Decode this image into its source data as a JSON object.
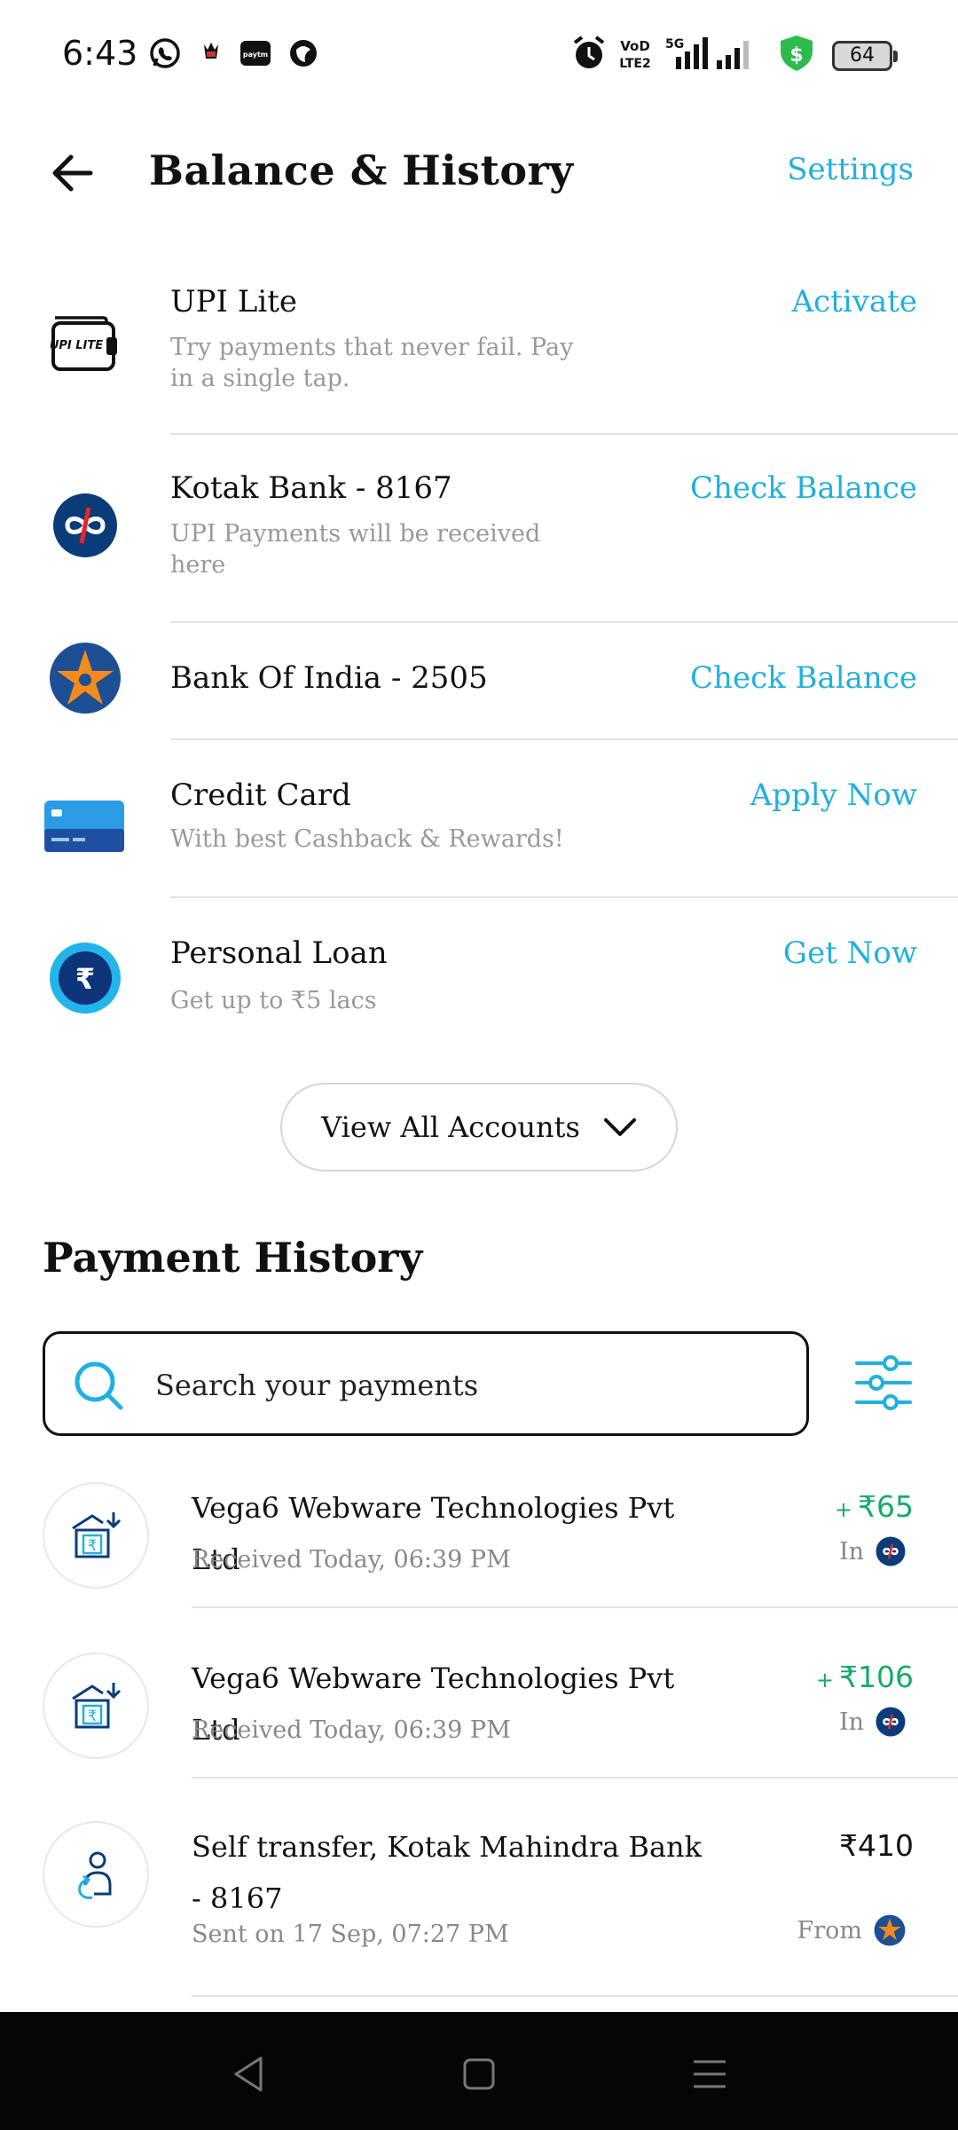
{
  "status_bar": {
    "time": "6:43",
    "battery": "64",
    "network": "5G"
  },
  "header": {
    "title": "Balance & History",
    "settings_label": "Settings"
  },
  "accounts": [
    {
      "name": "UPI Lite",
      "subtitle": "Try payments that never fail. Pay in a single tap.",
      "action": "Activate",
      "icon": "upi-lite-wallet-icon",
      "icon_text": "UPI LITE"
    },
    {
      "name": "Kotak Bank - 8167",
      "subtitle": "UPI Payments will be received here",
      "action": "Check Balance",
      "icon": "kotak-bank-icon"
    },
    {
      "name": "Bank Of India - 2505",
      "subtitle": "",
      "action": "Check Balance",
      "icon": "bank-of-india-icon"
    },
    {
      "name": "Credit Card",
      "subtitle": "With best Cashback & Rewards!",
      "action": "Apply Now",
      "icon": "credit-card-icon"
    },
    {
      "name": "Personal Loan",
      "subtitle": "Get up to ₹5 lacs",
      "action": "Get Now",
      "icon": "rupee-loan-icon",
      "icon_text": "₹"
    }
  ],
  "view_all_label": "View All Accounts",
  "payment_history": {
    "title": "Payment History",
    "search_placeholder": "Search your payments",
    "items": [
      {
        "name": "Vega6 Webware Technologies Pvt Ltd",
        "meta": "Received Today, 06:39 PM",
        "sign": "+",
        "amount": "₹65",
        "direction": "In",
        "bank": "kotak-bank-icon"
      },
      {
        "name": "Vega6 Webware Technologies Pvt Ltd",
        "meta": "Received Today, 06:39 PM",
        "sign": "+",
        "amount": "₹106",
        "direction": "In",
        "bank": "kotak-bank-icon"
      },
      {
        "name": "Self transfer, Kotak Mahindra Bank - 8167",
        "meta": "Sent on 17 Sep, 07:27 PM",
        "sign": "",
        "amount": "₹410",
        "direction": "From",
        "bank": "bank-of-india-icon"
      }
    ]
  },
  "colors": {
    "accent": "#21b0dd",
    "credit": "#1aa96a",
    "kotak_blue": "#0b3c7a",
    "kotak_red": "#e4262a",
    "boi_blue": "#1d4f95",
    "boi_orange": "#f28b1b"
  }
}
